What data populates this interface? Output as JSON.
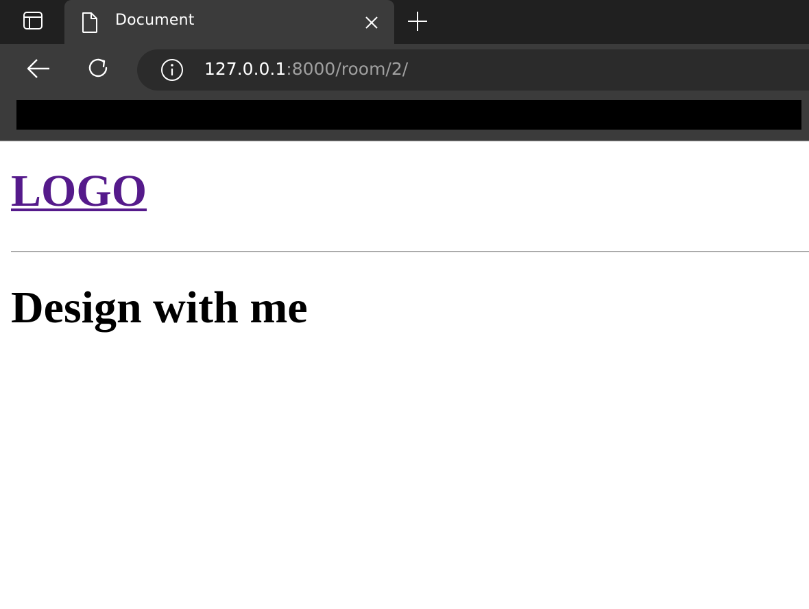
{
  "browser": {
    "tab": {
      "title": "Document",
      "favicon_icon": "document-icon",
      "close_icon": "close-icon"
    },
    "tab_actions_icon": "tab-actions-icon",
    "new_tab_icon": "plus-icon",
    "toolbar": {
      "back_icon": "arrow-left-icon",
      "refresh_icon": "refresh-icon",
      "site_info_icon": "info-icon"
    },
    "address": {
      "host": "127.0.0.1",
      "rest": ":8000/room/2/"
    }
  },
  "page": {
    "logo": "LOGO",
    "heading": "Design with me"
  },
  "colors": {
    "tabstrip_bg": "#202020",
    "toolbar_bg": "#3b3b3b",
    "address_bg": "#2b2b2b",
    "visited_link": "#551a8b"
  }
}
